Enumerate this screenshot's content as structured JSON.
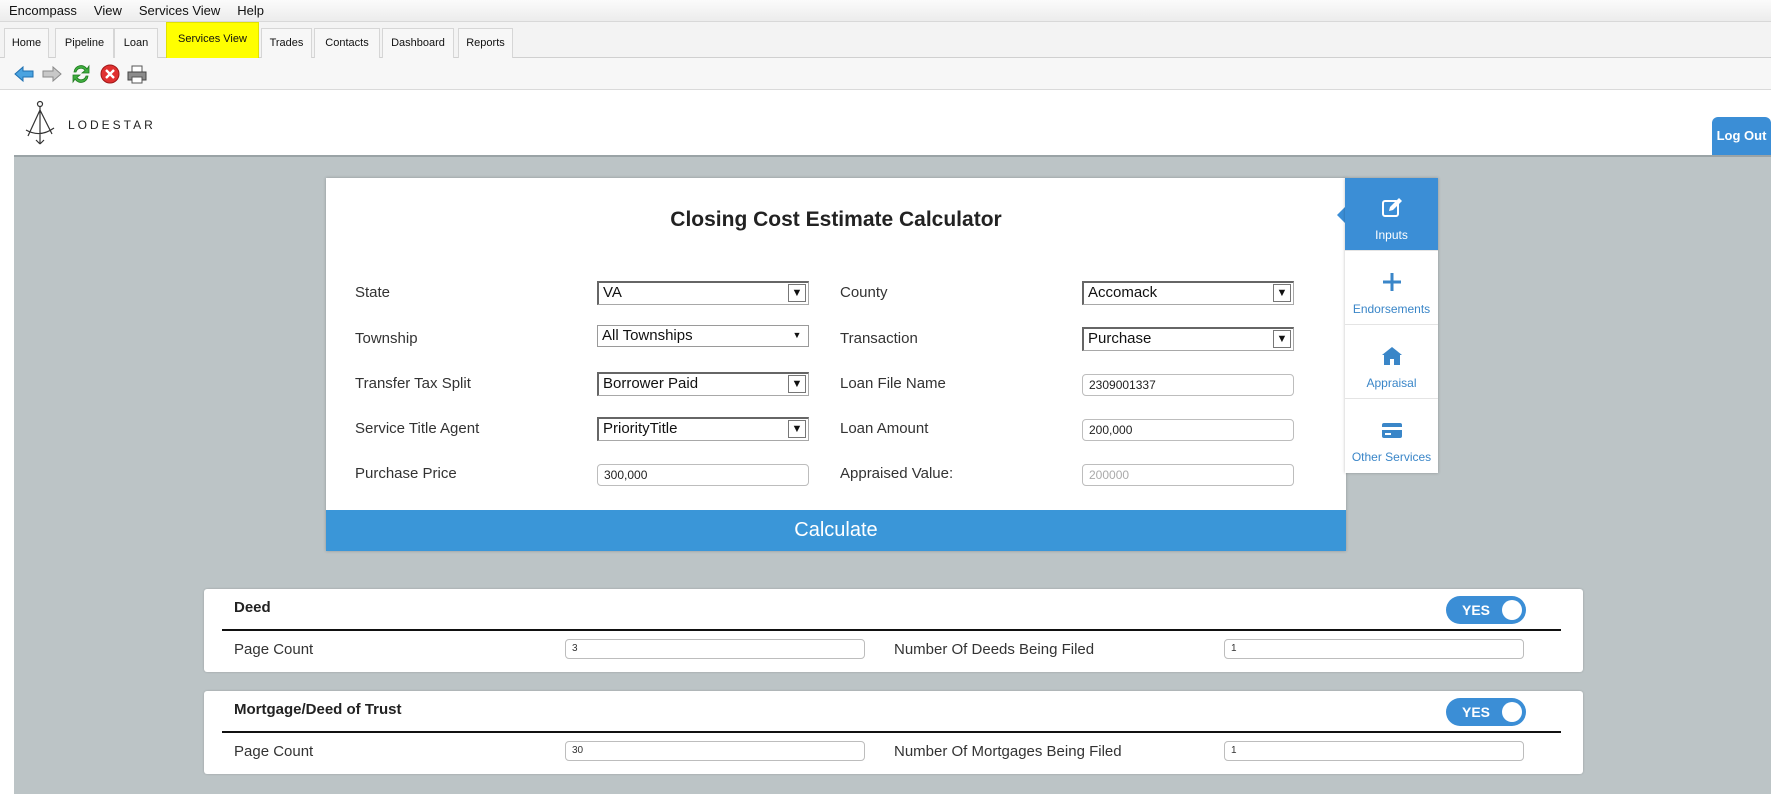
{
  "menu": [
    "Encompass",
    "View",
    "Services View",
    "Help"
  ],
  "tabs": [
    {
      "label": "Home",
      "active": false
    },
    {
      "label": "Pipeline",
      "active": false
    },
    {
      "label": "Loan",
      "active": false
    },
    {
      "label": "Services View",
      "active": true
    },
    {
      "label": "Trades",
      "active": false
    },
    {
      "label": "Contacts",
      "active": false
    },
    {
      "label": "Dashboard",
      "active": false
    },
    {
      "label": "Reports",
      "active": false
    }
  ],
  "toolbar": {
    "icons": [
      "back-arrow-icon",
      "forward-arrow-icon",
      "refresh-icon",
      "stop-icon",
      "print-icon"
    ]
  },
  "header": {
    "logo_text": "LODESTAR",
    "logout_label": "Log Out"
  },
  "calculator": {
    "title": "Closing Cost Estimate Calculator",
    "state_label": "State",
    "state_value": "VA",
    "county_label": "County",
    "county_value": "Accomack",
    "township_label": "Township",
    "township_value": "All Townships",
    "transaction_label": "Transaction",
    "transaction_value": "Purchase",
    "transfer_tax_label": "Transfer Tax Split",
    "transfer_tax_value": "Borrower Paid",
    "loan_file_label": "Loan File Name",
    "loan_file_value": "2309001337",
    "title_agent_label": "Service Title Agent",
    "title_agent_value": "PriorityTitle",
    "loan_amount_label": "Loan Amount",
    "loan_amount_value": "200,000",
    "purchase_price_label": "Purchase Price",
    "purchase_price_value": "300,000",
    "appraised_label": "Appraised Value:",
    "appraised_placeholder": "200000",
    "calculate_label": "Calculate"
  },
  "side_panel": [
    {
      "label": "Inputs",
      "icon": "edit-icon",
      "active": true
    },
    {
      "label": "Endorsements",
      "icon": "plus-icon",
      "active": false
    },
    {
      "label": "Appraisal",
      "icon": "home-icon",
      "active": false
    },
    {
      "label": "Other Services",
      "icon": "card-icon",
      "active": false
    }
  ],
  "deed": {
    "title": "Deed",
    "toggle": "YES",
    "page_count_label": "Page Count",
    "page_count_value": "3",
    "number_label": "Number Of Deeds Being Filed",
    "number_value": "1"
  },
  "mortgage": {
    "title": "Mortgage/Deed of Trust",
    "toggle": "YES",
    "page_count_label": "Page Count",
    "page_count_value": "30",
    "number_label": "Number Of Mortgages Being Filed",
    "number_value": "1"
  },
  "colors": {
    "accent": "#3b8ed6",
    "active_tab": "#ffff00",
    "background": "#bcc4c6"
  }
}
